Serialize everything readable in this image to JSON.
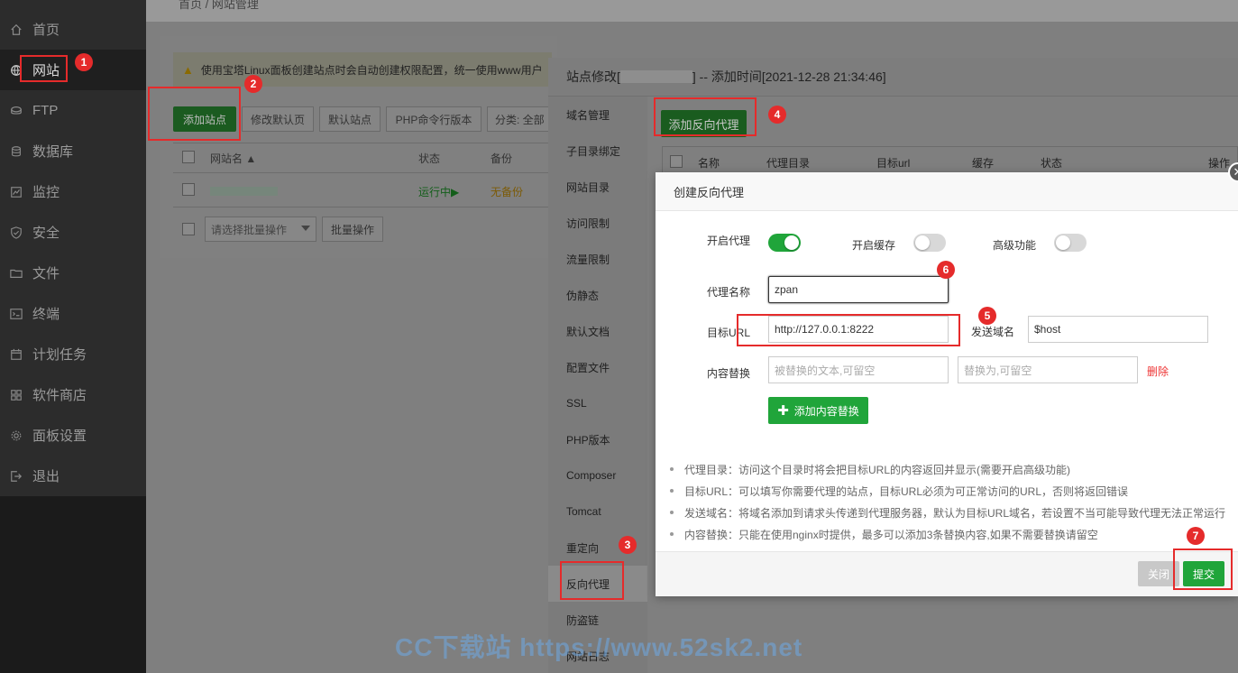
{
  "sidebar": {
    "items": [
      {
        "label": "首页",
        "icon": "home-icon"
      },
      {
        "label": "网站",
        "icon": "globe-icon"
      },
      {
        "label": "FTP",
        "icon": "ftp-icon"
      },
      {
        "label": "数据库",
        "icon": "database-icon"
      },
      {
        "label": "监控",
        "icon": "monitor-icon"
      },
      {
        "label": "安全",
        "icon": "shield-icon"
      },
      {
        "label": "文件",
        "icon": "folder-icon"
      },
      {
        "label": "终端",
        "icon": "terminal-icon"
      },
      {
        "label": "计划任务",
        "icon": "calendar-icon"
      },
      {
        "label": "软件商店",
        "icon": "grid-icon"
      },
      {
        "label": "面板设置",
        "icon": "gear-icon"
      },
      {
        "label": "退出",
        "icon": "logout-icon"
      }
    ]
  },
  "breadcrumb": "首页  /  网站管理",
  "website_page": {
    "alert": "使用宝塔Linux面板创建站点时会自动创建权限配置，统一使用www用户",
    "buttons": {
      "add_site": "添加站点",
      "edit_default_page": "修改默认页",
      "default_site": "默认站点",
      "php_cli_version": "PHP命令行版本",
      "category": "分类: 全部"
    },
    "table_headers": {
      "site_name": "网站名 ▲",
      "status": "状态",
      "backup": "备份"
    },
    "row": {
      "status": "运行中▶",
      "backup": "无备份"
    },
    "batch_select_placeholder": "请选择批量操作",
    "batch_button": "批量操作"
  },
  "site_window": {
    "title_prefix": "站点修改[",
    "title_suffix": "] -- 添加时间[2021-12-28 21:34:46]",
    "menu": [
      "域名管理",
      "子目录绑定",
      "网站目录",
      "访问限制",
      "流量限制",
      "伪静态",
      "默认文档",
      "配置文件",
      "SSL",
      "PHP版本",
      "Composer",
      "Tomcat",
      "重定向",
      "反向代理",
      "防盗链",
      "网站日志"
    ],
    "active_menu": "反向代理",
    "add_proxy_button": "添加反向代理",
    "table_headers": {
      "name": "名称",
      "proxy_dir": "代理目录",
      "target_url": "目标url",
      "cache": "缓存",
      "status": "状态",
      "action": "操作"
    }
  },
  "dialog": {
    "title": "创建反向代理",
    "close_glyph": "✕",
    "toggles": {
      "enable_proxy": {
        "label": "开启代理",
        "on": true
      },
      "enable_cache": {
        "label": "开启缓存",
        "on": false
      },
      "advanced": {
        "label": "高级功能",
        "on": false
      }
    },
    "proxy_name": {
      "label": "代理名称",
      "value": "zpan"
    },
    "target_url": {
      "label": "目标URL",
      "value": "http://127.0.0.1:8222"
    },
    "send_domain": {
      "label": "发送域名",
      "value": "$host"
    },
    "content_replace": {
      "label": "内容替换",
      "from_placeholder": "被替换的文本,可留空",
      "to_placeholder": "替换为,可留空",
      "delete_label": "删除"
    },
    "add_content_button": "添加内容替换",
    "help": [
      "代理目录：访问这个目录时将会把目标URL的内容返回并显示(需要开启高级功能)",
      "目标URL：可以填写你需要代理的站点，目标URL必须为可正常访问的URL，否则将返回错误",
      "发送域名：将域名添加到请求头传递到代理服务器，默认为目标URL域名，若设置不当可能导致代理无法正常运行",
      "内容替换：只能在使用nginx时提供，最多可以添加3条替换内容,如果不需要替换请留空"
    ],
    "close_button": "关闭",
    "submit_button": "提交"
  },
  "annotations": [
    "1",
    "2",
    "3",
    "4",
    "5",
    "6",
    "7"
  ],
  "watermark": "CC下载站 https://www.52sk2.net",
  "colors": {
    "accent_green": "#20a53a",
    "annotation_red": "#e52b2b",
    "delete_red": "#ee3333"
  }
}
